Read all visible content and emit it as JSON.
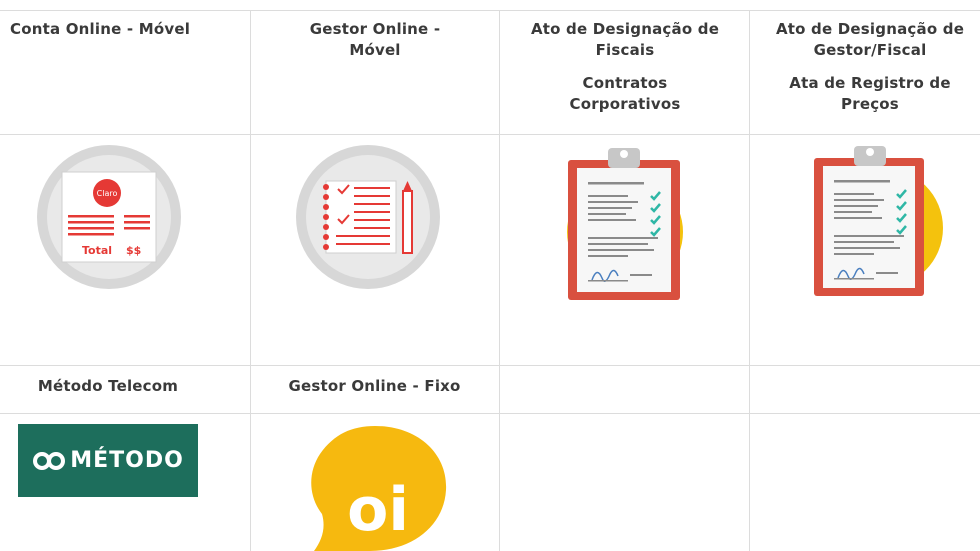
{
  "cells": {
    "conta_online_movel": {
      "title": "Conta Online - Móvel",
      "logo_text": "Claro",
      "total_label": "Total",
      "total_value": "$$"
    },
    "gestor_online_movel": {
      "title": "Gestor Online - Móvel"
    },
    "ato_fiscais": {
      "title": "Ato de Designação de Fiscais",
      "subtitle": "Contratos Corporativos"
    },
    "ato_gestor_fiscal": {
      "title": "Ato de Designação de Gestor/Fiscal",
      "subtitle": "Ata de Registro de Preços"
    },
    "metodo_telecom": {
      "title": "Método Telecom",
      "logo_text": "MÉTODO"
    },
    "gestor_online_fixo": {
      "title": "Gestor Online - Fixo",
      "logo_text": "oi"
    }
  },
  "colors": {
    "claro_red": "#e53935",
    "gray_circle": "#d7d7d7",
    "clipboard_red": "#d9503f",
    "yellow": "#f4c20d",
    "check_teal": "#2fb7a6",
    "metodo_green": "#1d6e5c",
    "oi_yellow": "#f6b90f"
  }
}
